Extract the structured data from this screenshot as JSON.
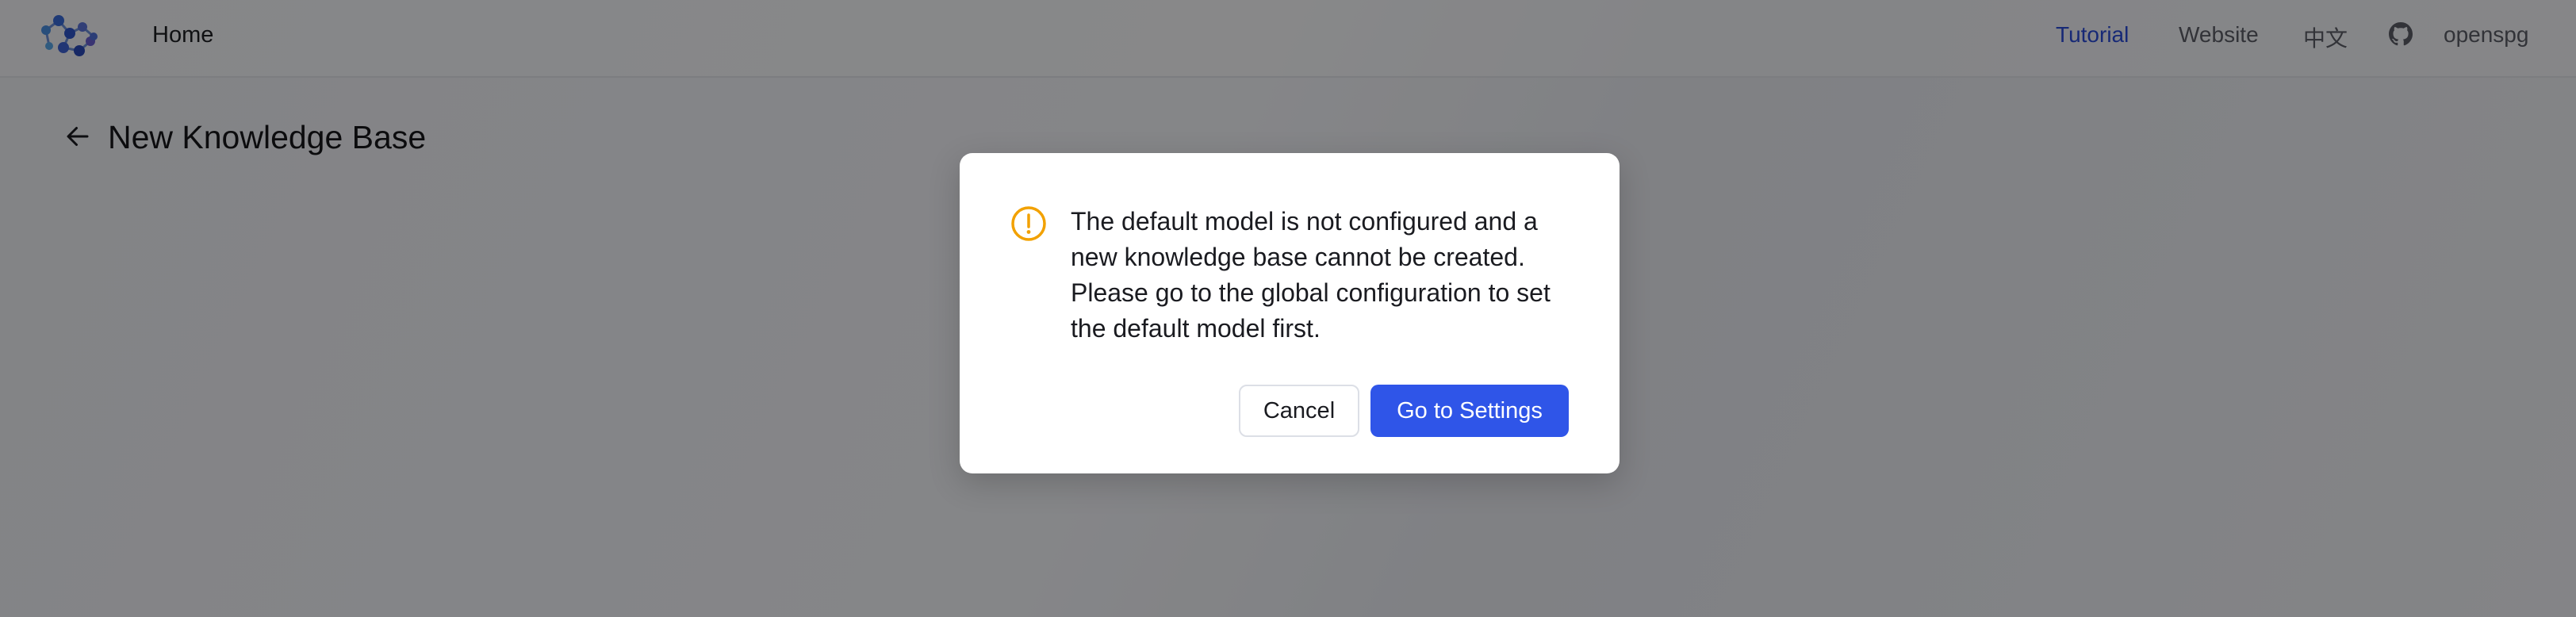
{
  "header": {
    "home_label": "Home",
    "nav": {
      "tutorial": "Tutorial",
      "website": "Website",
      "language": "中文",
      "github_icon": "github-icon",
      "openspg": "openspg"
    }
  },
  "page": {
    "back_icon": "arrow-left-icon",
    "title": "New Knowledge Base"
  },
  "dialog": {
    "icon": "warning-circle-icon",
    "message": "The default model is not configured and a new knowledge base cannot be created. Please go to the global configuration to set the default model first.",
    "cancel_label": "Cancel",
    "confirm_label": "Go to Settings"
  },
  "colors": {
    "accent": "#2f55e8",
    "nav_active": "#2a4bd8",
    "warning": "#f2a100"
  }
}
